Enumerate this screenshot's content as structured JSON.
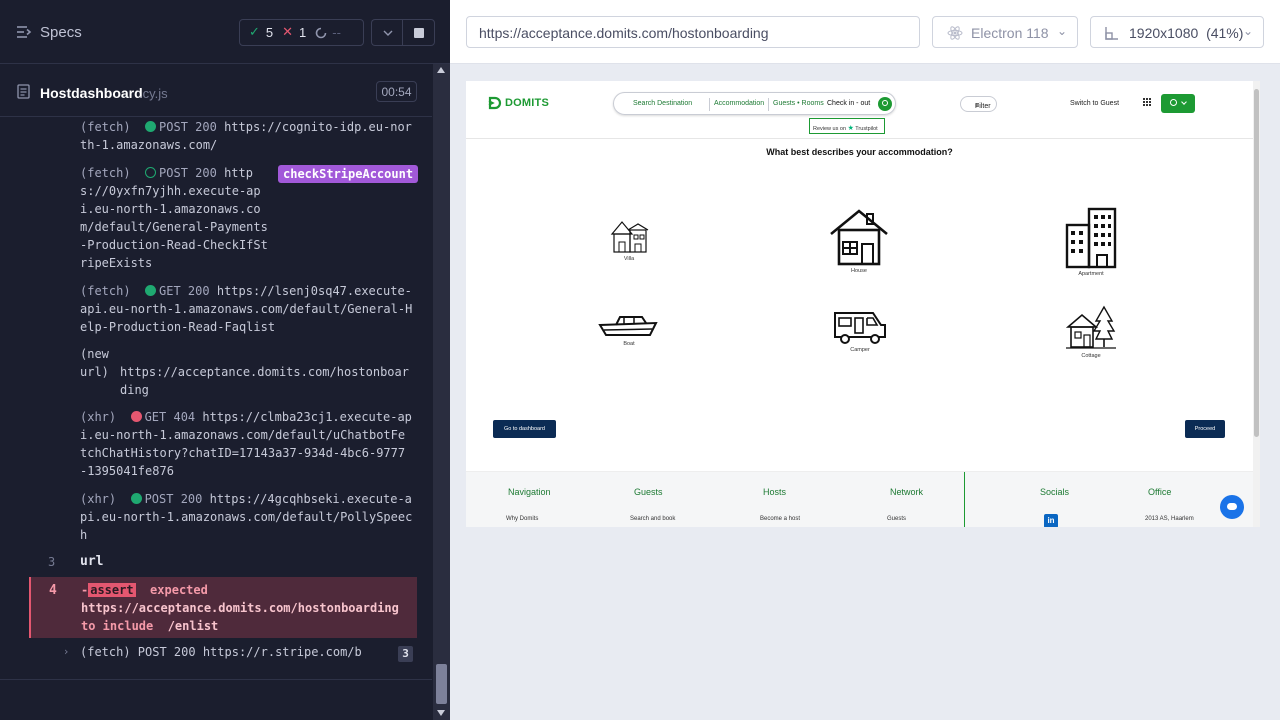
{
  "reporter": {
    "title": "Specs",
    "stats": {
      "passed": "5",
      "failed": "1",
      "pending": "--"
    },
    "spec_file": {
      "name": "Hostdashboard",
      "ext": ".cy.js",
      "duration": "00:54"
    },
    "log": [
      {
        "kind": "(fetch)",
        "status_color": "green",
        "method": "POST 200",
        "url": "https://cognito-idp.eu-north-1.amazonaws.com/"
      },
      {
        "kind": "(fetch)",
        "status_color": "hollow",
        "method": "POST 200",
        "url": "https://0yxfn7yjhh.execute-api.eu-north-1.amazonaws.com/default/General-Payments-Production-Read-CheckIfStripeExists",
        "alias": "checkStripeAccount"
      },
      {
        "kind": "(fetch)",
        "status_color": "green",
        "method": "GET 200",
        "url": "https://lsenj0sq47.execute-api.eu-north-1.amazonaws.com/default/General-Help-Production-Read-Faqlist"
      },
      {
        "kind": "(new url)",
        "url": "https://acceptance.domits.com/hostonboarding"
      },
      {
        "kind": "(xhr)",
        "status_color": "red",
        "method": "GET 404",
        "url": "https://clmba23cj1.execute-api.eu-north-1.amazonaws.com/default/uChatbotFetchChatHistory?chatID=17143a37-934d-4bc6-9777-1395041fe876"
      },
      {
        "kind": "(xhr)",
        "status_color": "green",
        "method": "POST 200",
        "url": "https://4gcqhbseki.execute-api.eu-north-1.amazonaws.com/default/PollySpeech"
      }
    ],
    "step3": {
      "num": "3",
      "label": "url"
    },
    "assert": {
      "num": "4",
      "prefix": "-",
      "keyword": "assert",
      "expected": "expected",
      "value": "https://acceptance.domits.com/hostonboarding",
      "to_include": "to include",
      "target": "/enlist"
    },
    "stripe_row": {
      "text": "(fetch)  POST 200 https://r.stripe.com/b",
      "count": "3"
    }
  },
  "aut": {
    "url": "https://acceptance.domits.com/hostonboarding",
    "browser": "Electron 118",
    "viewport": "1920x1080  (41%)"
  },
  "domits": {
    "logo": "DOMITS",
    "search": {
      "destination": "Search Destination",
      "accommodation": "Accommodation",
      "guests": "Guests • Rooms",
      "checkin": "Check in - out"
    },
    "trustpilot": {
      "prefix": "Review us on",
      "brand": "Trustpilot"
    },
    "filter": "Filter",
    "switch": "Switch to Guest",
    "question": "What best describes your accommodation?",
    "types": [
      "Villa",
      "House",
      "Apartment",
      "Boat",
      "Camper",
      "Cottage"
    ],
    "buttons": {
      "dashboard": "Go to dashboard",
      "proceed": "Proceed"
    },
    "footer": {
      "columns": [
        {
          "title": "Navigation",
          "item": "Why Domits"
        },
        {
          "title": "Guests",
          "item": "Search and book"
        },
        {
          "title": "Hosts",
          "item": "Become a host"
        },
        {
          "title": "Network",
          "item": "Guests"
        },
        {
          "title": "Socials",
          "item": ""
        },
        {
          "title": "Office",
          "item": "2013 AS, Haarlem"
        }
      ],
      "linkedin": "in"
    }
  },
  "colors": {
    "reporter_bg": "#1b1e2e",
    "pass": "#1fa971",
    "fail": "#e45770",
    "alias": "#a259d9",
    "domits_green": "#1d9a33",
    "domits_navy": "#0b2b54"
  }
}
